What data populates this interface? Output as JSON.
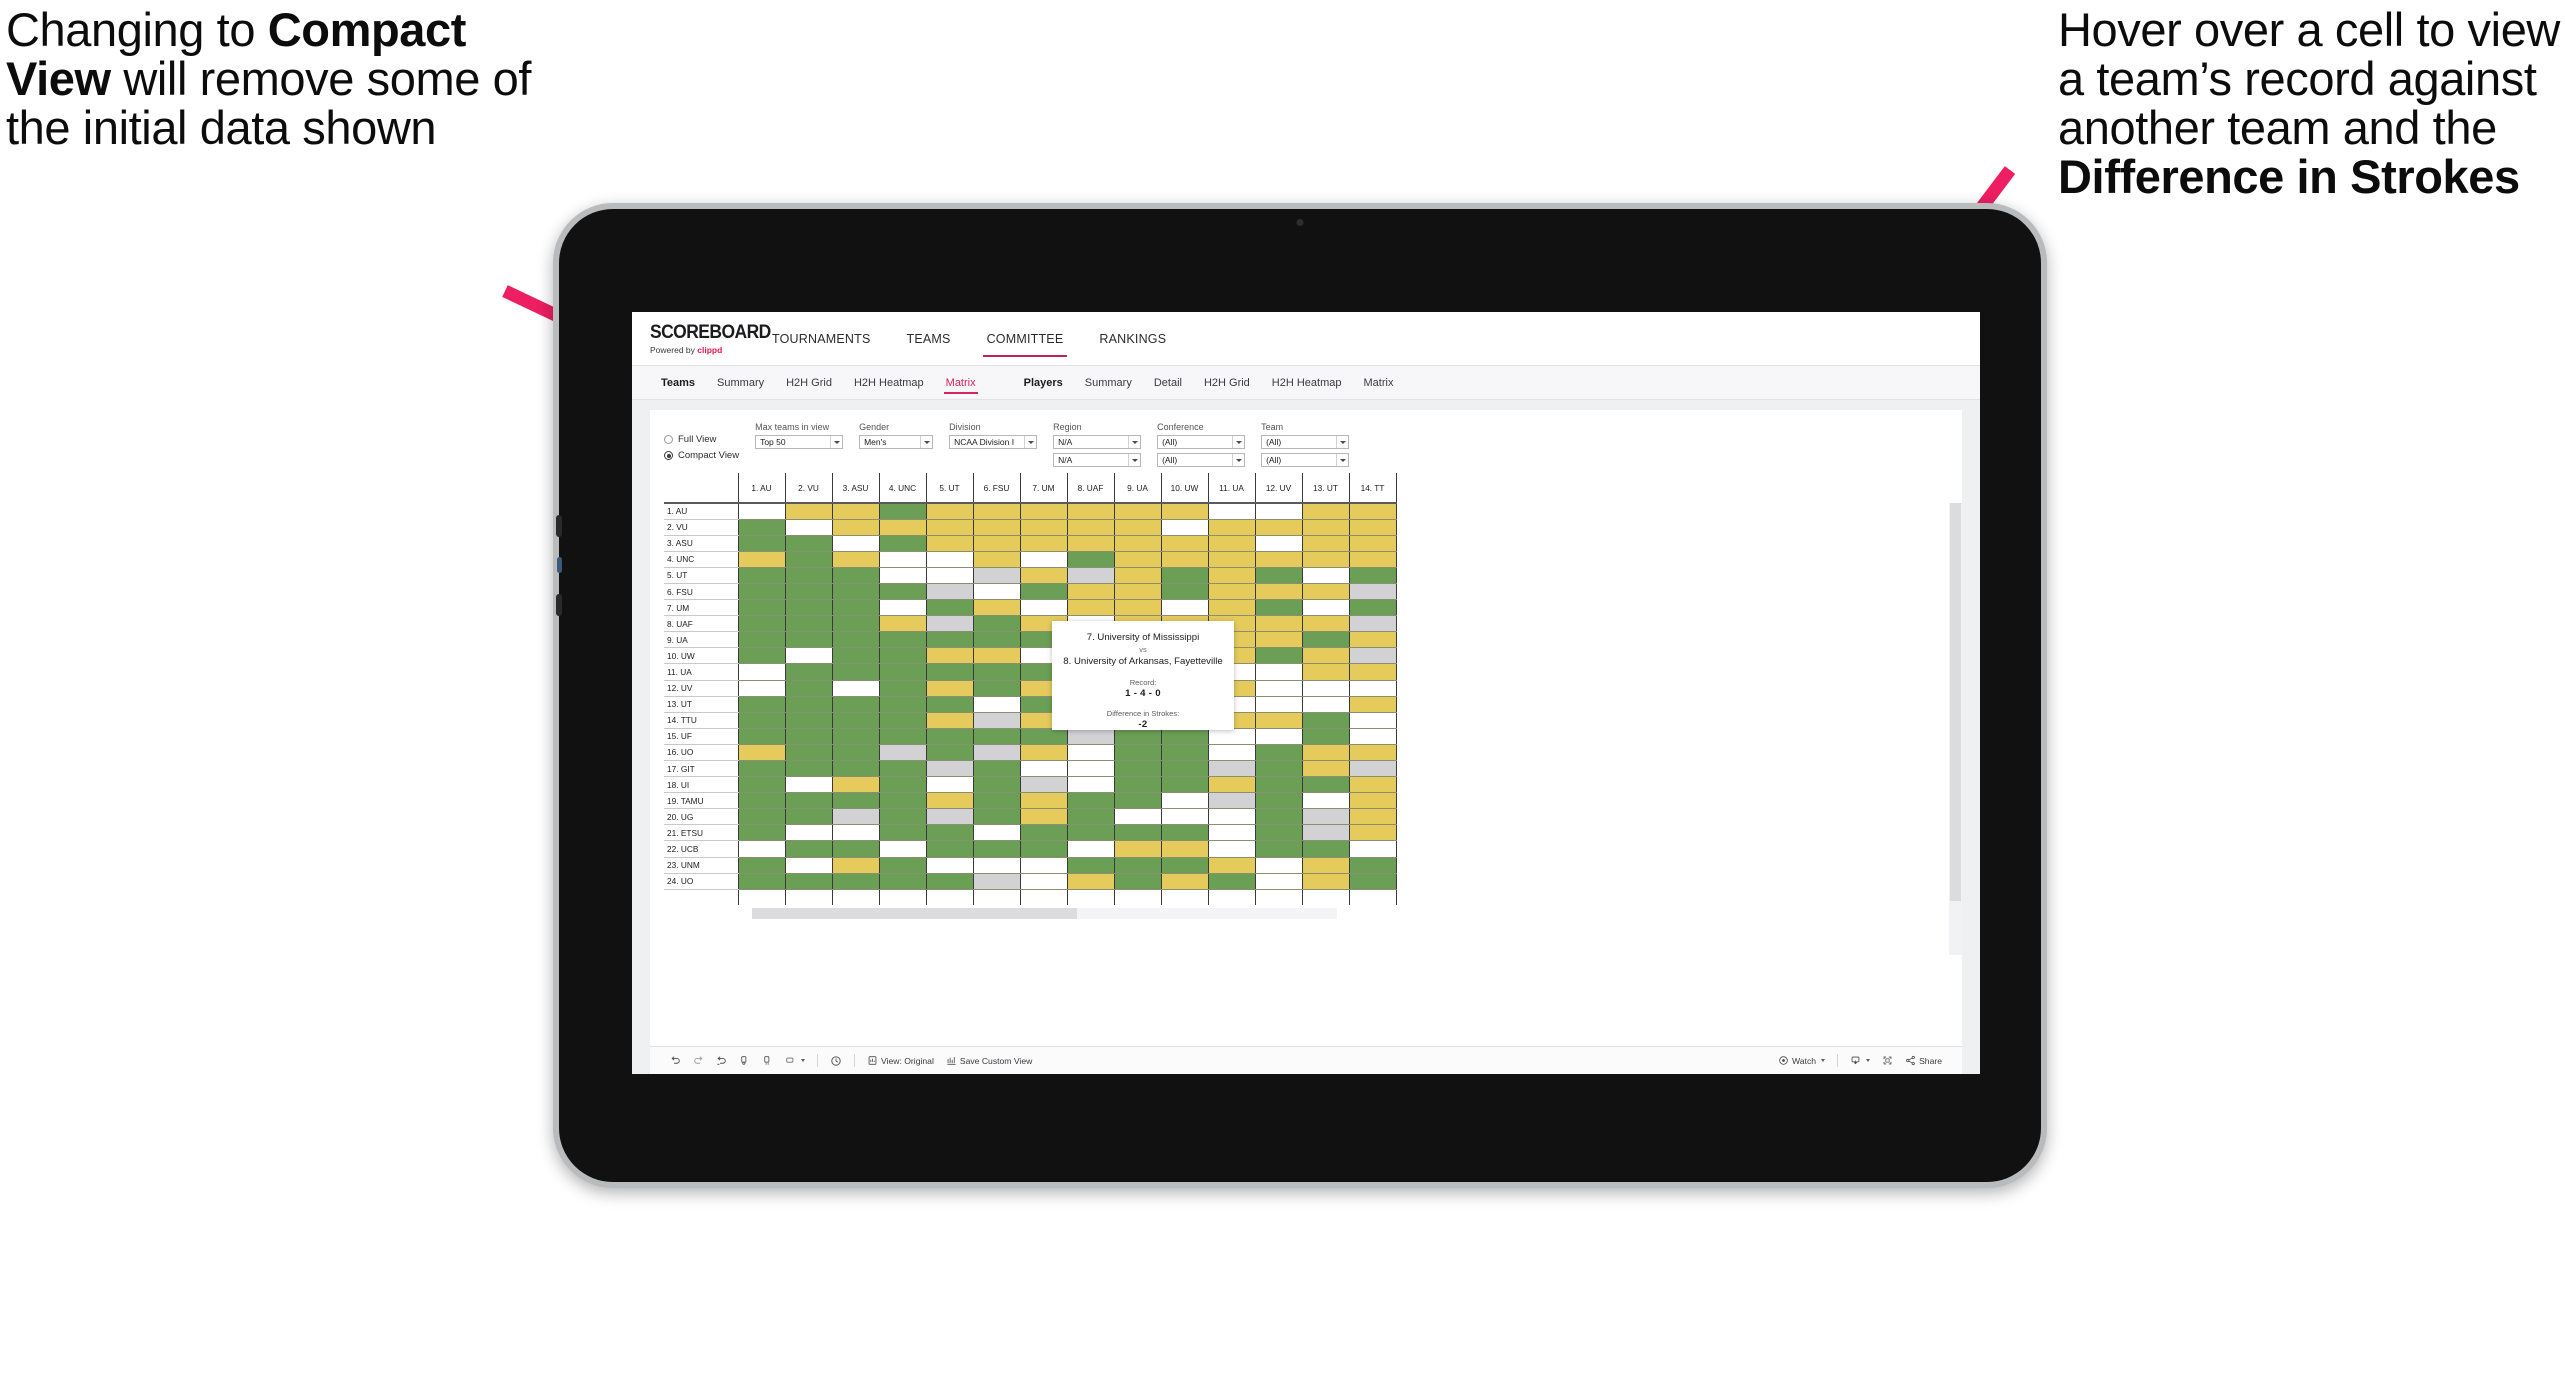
{
  "annotations": {
    "left": {
      "part1": "Changing to ",
      "bold": "Compact View",
      "part2": " will remove some of the initial data shown"
    },
    "right": {
      "part1": "Hover over a cell to view a team’s record against another team and the ",
      "bold": "Difference in Strokes",
      "part2": ""
    },
    "arrow_color": "#ED1E62"
  },
  "app": {
    "brand": {
      "title": "SCOREBOARD",
      "powered_prefix": "Powered by ",
      "powered_accent": "clippd"
    },
    "top_nav": [
      {
        "label": "TOURNAMENTS",
        "active": false
      },
      {
        "label": "TEAMS",
        "active": false
      },
      {
        "label": "COMMITTEE",
        "active": true
      },
      {
        "label": "RANKINGS",
        "active": false
      }
    ],
    "sub_nav_teams": [
      {
        "label": "Teams",
        "head": true,
        "active": false
      },
      {
        "label": "Summary",
        "head": false,
        "active": false
      },
      {
        "label": "H2H Grid",
        "head": false,
        "active": false
      },
      {
        "label": "H2H Heatmap",
        "head": false,
        "active": false
      },
      {
        "label": "Matrix",
        "head": false,
        "active": true
      }
    ],
    "sub_nav_players": [
      {
        "label": "Players",
        "head": true,
        "active": false
      },
      {
        "label": "Summary",
        "head": false,
        "active": false
      },
      {
        "label": "Detail",
        "head": false,
        "active": false
      },
      {
        "label": "H2H Grid",
        "head": false,
        "active": false
      },
      {
        "label": "H2H Heatmap",
        "head": false,
        "active": false
      },
      {
        "label": "Matrix",
        "head": false,
        "active": false
      }
    ]
  },
  "filters": {
    "view_mode": {
      "options": [
        {
          "label": "Full View",
          "selected": false
        },
        {
          "label": "Compact View",
          "selected": true
        }
      ]
    },
    "max_teams": {
      "label": "Max teams in view",
      "value": "Top 50"
    },
    "gender": {
      "label": "Gender",
      "value": "Men's"
    },
    "division": {
      "label": "Division",
      "value": "NCAA Division I"
    },
    "region": {
      "label": "Region",
      "value": "N/A",
      "value2": "N/A"
    },
    "conference": {
      "label": "Conference",
      "value": "(All)",
      "value2": "(All)"
    },
    "team": {
      "label": "Team",
      "value": "(All)",
      "value2": "(All)"
    }
  },
  "matrix": {
    "columns": [
      "1. AU",
      "2. VU",
      "3. ASU",
      "4. UNC",
      "5. UT",
      "6. FSU",
      "7. UM",
      "8. UAF",
      "9. UA",
      "10. UW",
      "11. UA",
      "12. UV",
      "13. UT",
      "14. TT"
    ],
    "rows": [
      "1. AU",
      "2. VU",
      "3. ASU",
      "4. UNC",
      "5. UT",
      "6. FSU",
      "7. UM",
      "8. UAF",
      "9. UA",
      "10. UW",
      "11. UA",
      "12. UV",
      "13. UT",
      "14. TTU",
      "15. UF",
      "16. UO",
      "17. GIT",
      "18. UI",
      "19. TAMU",
      "20. UG",
      "21. ETSU",
      "22. UCB",
      "23. UNM",
      "24. UO"
    ],
    "legend": {
      "win": "#6c9f56",
      "loss": "#e5cb5c",
      "none": "#ffffff",
      "tie": "#d2d2d4"
    },
    "cells": [
      [
        "w",
        "y",
        "y",
        "g",
        "y",
        "y",
        "y",
        "y",
        "y",
        "y",
        "w",
        "w",
        "y",
        "y"
      ],
      [
        "g",
        "w",
        "y",
        "y",
        "y",
        "y",
        "y",
        "y",
        "y",
        "w",
        "y",
        "y",
        "y",
        "y"
      ],
      [
        "g",
        "g",
        "w",
        "g",
        "y",
        "y",
        "y",
        "y",
        "y",
        "y",
        "y",
        "w",
        "y",
        "y"
      ],
      [
        "y",
        "g",
        "y",
        "w",
        "w",
        "y",
        "w",
        "g",
        "y",
        "y",
        "y",
        "y",
        "y",
        "y"
      ],
      [
        "g",
        "g",
        "g",
        "w",
        "w",
        "s",
        "y",
        "s",
        "y",
        "g",
        "y",
        "g",
        "w",
        "g"
      ],
      [
        "g",
        "g",
        "g",
        "g",
        "s",
        "w",
        "g",
        "y",
        "y",
        "g",
        "y",
        "y",
        "y",
        "s"
      ],
      [
        "g",
        "g",
        "g",
        "w",
        "g",
        "y",
        "w",
        "y",
        "y",
        "w",
        "y",
        "g",
        "w",
        "g"
      ],
      [
        "g",
        "g",
        "g",
        "y",
        "s",
        "g",
        "y",
        "w",
        "y",
        "y",
        "y",
        "y",
        "y",
        "s"
      ],
      [
        "g",
        "g",
        "g",
        "g",
        "g",
        "g",
        "g",
        "g",
        "w",
        "g",
        "y",
        "y",
        "g",
        "y"
      ],
      [
        "g",
        "w",
        "g",
        "g",
        "y",
        "y",
        "w",
        "g",
        "g",
        "w",
        "y",
        "g",
        "y",
        "s"
      ],
      [
        "w",
        "g",
        "g",
        "g",
        "g",
        "g",
        "g",
        "g",
        "y",
        "y",
        "w",
        "w",
        "y",
        "y"
      ],
      [
        "w",
        "g",
        "w",
        "g",
        "y",
        "g",
        "y",
        "g",
        "y",
        "w",
        "y",
        "w",
        "w",
        "w"
      ],
      [
        "g",
        "g",
        "g",
        "g",
        "g",
        "w",
        "g",
        "y",
        "w",
        "y",
        "w",
        "w",
        "w",
        "y"
      ],
      [
        "g",
        "g",
        "g",
        "g",
        "y",
        "s",
        "y",
        "w",
        "g",
        "y",
        "y",
        "y",
        "g",
        "w"
      ],
      [
        "g",
        "g",
        "g",
        "g",
        "g",
        "g",
        "g",
        "s",
        "g",
        "g",
        "w",
        "w",
        "g",
        "w"
      ],
      [
        "y",
        "g",
        "g",
        "s",
        "g",
        "s",
        "y",
        "w",
        "g",
        "g",
        "w",
        "g",
        "y",
        "y"
      ],
      [
        "g",
        "g",
        "g",
        "g",
        "s",
        "g",
        "w",
        "w",
        "g",
        "g",
        "s",
        "g",
        "y",
        "s"
      ],
      [
        "g",
        "w",
        "y",
        "g",
        "w",
        "g",
        "s",
        "w",
        "g",
        "g",
        "y",
        "g",
        "g",
        "y"
      ],
      [
        "g",
        "g",
        "g",
        "g",
        "y",
        "g",
        "y",
        "g",
        "g",
        "w",
        "s",
        "g",
        "w",
        "y"
      ],
      [
        "g",
        "g",
        "s",
        "g",
        "s",
        "g",
        "y",
        "g",
        "w",
        "w",
        "w",
        "g",
        "s",
        "y"
      ],
      [
        "g",
        "w",
        "w",
        "g",
        "g",
        "w",
        "g",
        "g",
        "g",
        "g",
        "w",
        "g",
        "s",
        "y"
      ],
      [
        "w",
        "g",
        "g",
        "w",
        "g",
        "g",
        "g",
        "w",
        "y",
        "y",
        "w",
        "g",
        "g",
        "w"
      ],
      [
        "g",
        "w",
        "y",
        "g",
        "w",
        "w",
        "w",
        "g",
        "g",
        "g",
        "y",
        "w",
        "y",
        "g"
      ],
      [
        "g",
        "g",
        "g",
        "g",
        "g",
        "s",
        "w",
        "y",
        "g",
        "y",
        "g",
        "w",
        "y",
        "g"
      ]
    ]
  },
  "tooltip": {
    "team_a": "7. University of Mississippi",
    "vs": "vs",
    "team_b": "8. University of Arkansas, Fayetteville",
    "record_label": "Record:",
    "record_value": "1 - 4 - 0",
    "diff_label": "Difference in Strokes:",
    "diff_value": "-2"
  },
  "toolbar": {
    "view_original": "View: Original",
    "save_custom_view": "Save Custom View",
    "watch": "Watch",
    "share": "Share"
  }
}
